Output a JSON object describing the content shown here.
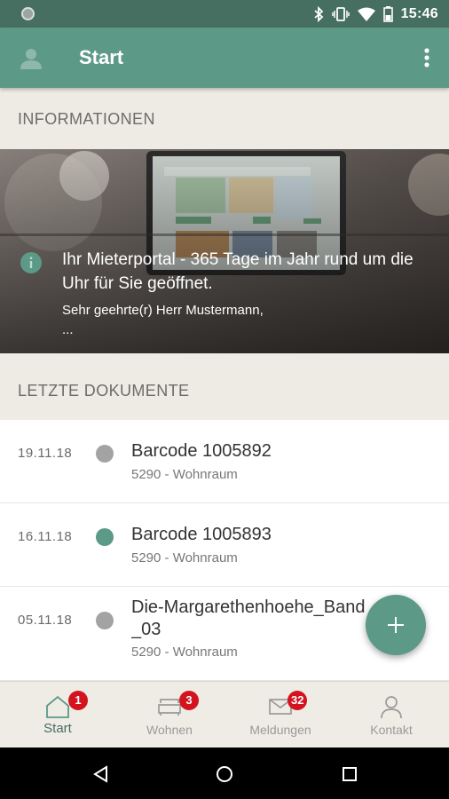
{
  "status_bar": {
    "time": "15:46"
  },
  "app_bar": {
    "title": "Start"
  },
  "sections": {
    "info_header": "INFORMATIONEN",
    "docs_header": "LETZTE DOKUMENTE"
  },
  "banner": {
    "title": "Ihr Mieterportal - 365 Tage im Jahr rund um die Uhr für Sie geöffnet.",
    "subtitle": "Sehr geehrte(r) Herr Mustermann,",
    "ellipsis": "..."
  },
  "documents": [
    {
      "date": "19.11.18",
      "title": "Barcode 1005892",
      "subtitle": "5290 - Wohnraum",
      "status_color": "#a3a3a3"
    },
    {
      "date": "16.11.18",
      "title": "Barcode 1005893",
      "subtitle": "5290 - Wohnraum",
      "status_color": "#5c9987"
    },
    {
      "date": "05.11.18",
      "title": "Die-Margarethenhoehe_Band_03",
      "subtitle": "5290 - Wohnraum",
      "status_color": "#a3a3a3"
    }
  ],
  "bottom_nav": [
    {
      "label": "Start",
      "badge": "1",
      "icon": "home-icon",
      "active": true
    },
    {
      "label": "Wohnen",
      "badge": "3",
      "icon": "sofa-icon",
      "active": false
    },
    {
      "label": "Meldungen",
      "badge": "32",
      "icon": "mail-icon",
      "active": false
    },
    {
      "label": "Kontakt",
      "badge": "",
      "icon": "person-icon",
      "active": false
    }
  ],
  "colors": {
    "primary": "#5c9987",
    "primary_dark": "#466e61",
    "badge": "#d3141e",
    "background": "#eeebe4"
  }
}
